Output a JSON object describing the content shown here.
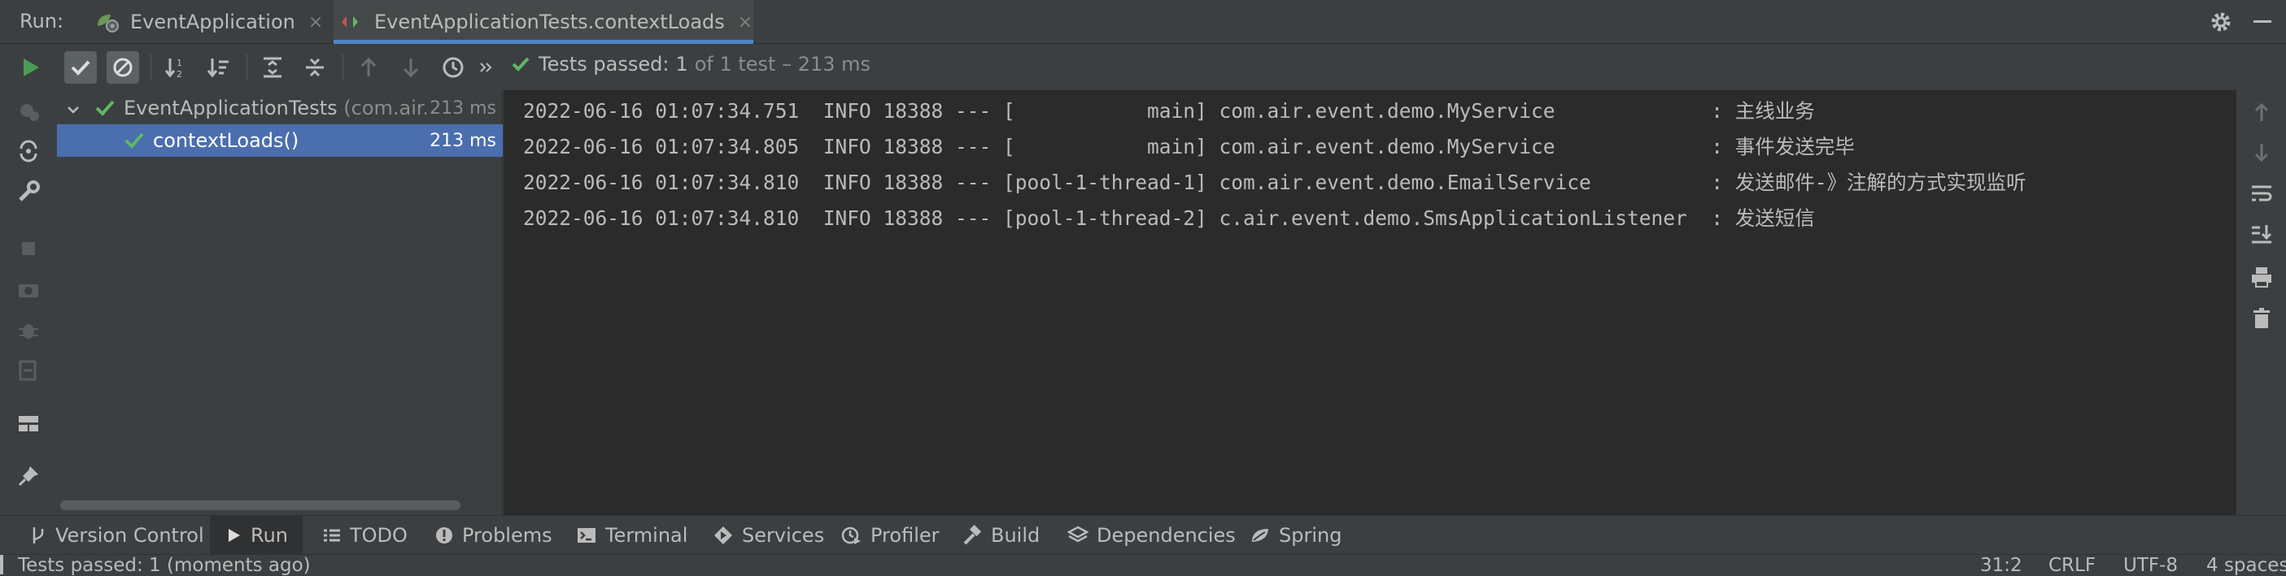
{
  "run_bar": {
    "label": "Run:",
    "tabs": [
      {
        "label": "EventApplication",
        "close": "×"
      },
      {
        "label": "EventApplicationTests.contextLoads",
        "close": "×"
      }
    ]
  },
  "toolbar": {
    "status_passed": "Tests passed:",
    "status_count": "1",
    "status_detail": "of 1 test – 213 ms"
  },
  "tree": {
    "rows": [
      {
        "name": "EventApplicationTests",
        "package": "(com.air.ev",
        "time": "213 ms"
      },
      {
        "name": "contextLoads()",
        "time": "213 ms"
      }
    ]
  },
  "console": {
    "lines": [
      "2022-06-16 01:07:34.751  INFO 18388 --- [           main] com.air.event.demo.MyService             : 主线业务",
      "2022-06-16 01:07:34.805  INFO 18388 --- [           main] com.air.event.demo.MyService             : 事件发送完毕",
      "2022-06-16 01:07:34.810  INFO 18388 --- [pool-1-thread-1] com.air.event.demo.EmailService          : 发送邮件-》注解的方式实现监听",
      "2022-06-16 01:07:34.810  INFO 18388 --- [pool-1-thread-2] c.air.event.demo.SmsApplicationListener  : 发送短信"
    ]
  },
  "bottom_tabs": {
    "version_control": "Version Control",
    "run": "Run",
    "todo": "TODO",
    "problems": "Problems",
    "terminal": "Terminal",
    "services": "Services",
    "profiler": "Profiler",
    "build": "Build",
    "dependencies": "Dependencies",
    "spring": "Spring"
  },
  "status_bar": {
    "message": "Tests passed: 1 (moments ago)",
    "position": "31:2",
    "line_sep": "CRLF",
    "encoding": "UTF-8",
    "indent": "4 spaces"
  },
  "colors": {
    "success_green": "#5fb865",
    "run_green": "#499c54",
    "selection_blue": "#4b6eaf",
    "tab_underline": "#4a88c7"
  },
  "icons": [
    "rerun-icon",
    "show-passed-icon",
    "show-ignored-icon",
    "sort-alpha-icon",
    "sort-duration-icon",
    "expand-all-icon",
    "collapse-all-icon",
    "prev-failed-icon",
    "next-failed-icon",
    "history-icon",
    "gear-icon"
  ]
}
